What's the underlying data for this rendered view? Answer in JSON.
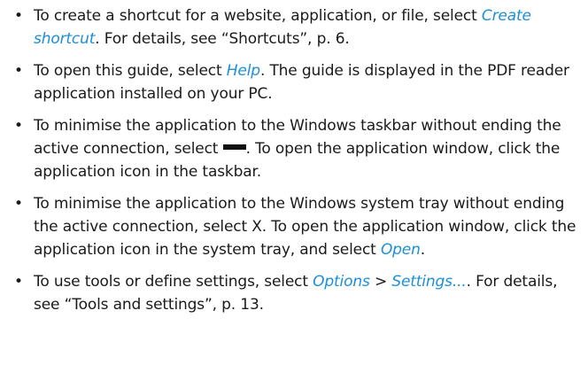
{
  "bullets": [
    {
      "parts": [
        {
          "type": "text",
          "value": "To create a shortcut for a website, application, or file, select "
        },
        {
          "type": "link",
          "value": "Create shortcut"
        },
        {
          "type": "text",
          "value": ". For details, see “Shortcuts”, p. 6."
        }
      ]
    },
    {
      "parts": [
        {
          "type": "text",
          "value": "To open this guide, select "
        },
        {
          "type": "link",
          "value": "Help"
        },
        {
          "type": "text",
          "value": ". The guide is displayed in the PDF reader application installed on your PC."
        }
      ]
    },
    {
      "parts": [
        {
          "type": "text",
          "value": "To minimise the application to the Windows taskbar without ending the active connection, select "
        },
        {
          "type": "icon",
          "value": "minimize-icon"
        },
        {
          "type": "text",
          "value": ". To open the application window, click the application icon in the taskbar."
        }
      ]
    },
    {
      "parts": [
        {
          "type": "text",
          "value": "To minimise the application to the Windows system tray without ending the active connection, select X. To open the application window, click the application icon in the system tray, and select "
        },
        {
          "type": "link",
          "value": "Open"
        },
        {
          "type": "text",
          "value": "."
        }
      ]
    },
    {
      "parts": [
        {
          "type": "text",
          "value": "To use tools or define settings, select "
        },
        {
          "type": "link",
          "value": "Options"
        },
        {
          "type": "text",
          "value": " > "
        },
        {
          "type": "link",
          "value": "Settings..."
        },
        {
          "type": "text",
          "value": ". For details, see “Tools and settings”, p. 13."
        }
      ]
    }
  ],
  "colors": {
    "link": "#1b8fd6",
    "text": "#1a1a1a",
    "background": "#ffffff"
  }
}
